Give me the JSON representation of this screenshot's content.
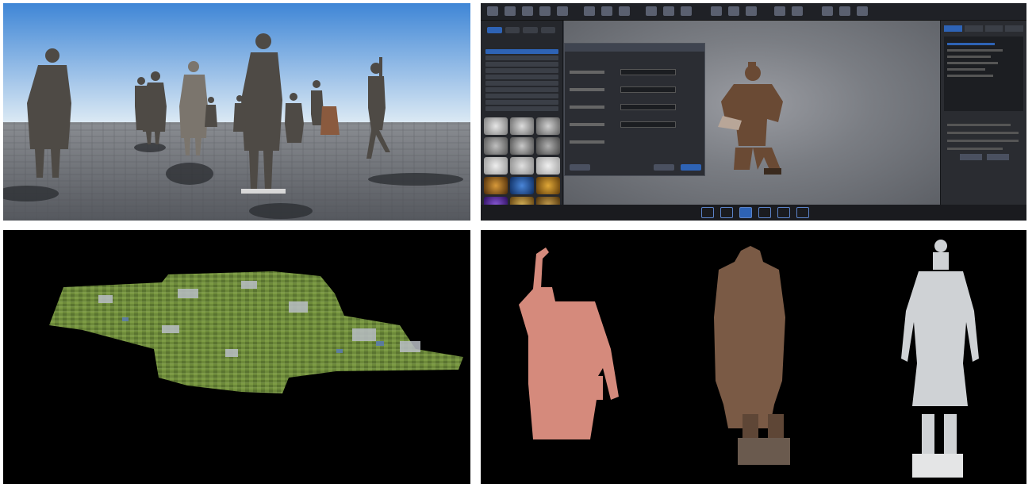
{
  "panels": [
    {
      "id": "sky",
      "description_name": "terracotta-warriors-3d-scene"
    },
    {
      "id": "ui",
      "description_name": "3d-modeling-software"
    },
    {
      "id": "map",
      "description_name": "oblique-photogrammetry-terrain"
    },
    {
      "id": "figs",
      "description_name": "terracotta-figure-models"
    }
  ],
  "colors": {
    "sky_top": "#3f86d6",
    "sky_bottom": "#dbe9f4",
    "ground": "#6f7379",
    "terracotta": "#5a4a3c",
    "ui_accent": "#2e63b5",
    "figure_red": "#d58a7c",
    "figure_brown": "#7a5a45",
    "figure_white": "#cfd2d5"
  }
}
